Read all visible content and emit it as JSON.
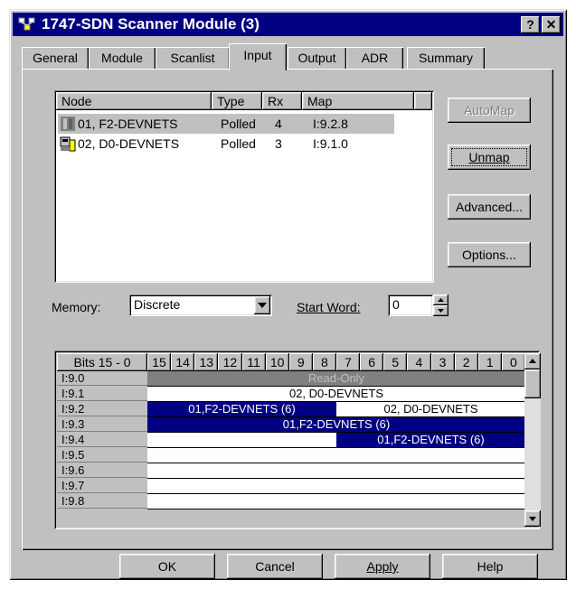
{
  "window": {
    "title": "1747-SDN Scanner Module (3)",
    "help_btn": "?",
    "close_btn": "✕"
  },
  "tabs": [
    "General",
    "Module",
    "Scanlist",
    "Input",
    "Output",
    "ADR",
    "Summary"
  ],
  "active_tab": "Input",
  "device_list": {
    "columns": [
      "Node",
      "Type",
      "Rx",
      "Map"
    ],
    "rows": [
      {
        "node": "01, F2-DEVNETS",
        "type": "Polled",
        "rx": "4",
        "map": "I:9.2.8",
        "selected": true
      },
      {
        "node": "02, D0-DEVNETS",
        "type": "Polled",
        "rx": "3",
        "map": "I:9.1.0",
        "selected": false
      }
    ]
  },
  "side_buttons": {
    "automap": "AutoMap",
    "unmap": "Unmap",
    "advanced": "Advanced...",
    "options": "Options..."
  },
  "memory": {
    "label": "Memory:",
    "value": "Discrete"
  },
  "start_word": {
    "label": "Start Word:",
    "value": "0"
  },
  "bit_grid": {
    "header_label": "Bits 15 - 0",
    "bits": [
      "15",
      "14",
      "13",
      "12",
      "11",
      "10",
      "9",
      "8",
      "7",
      "6",
      "5",
      "4",
      "3",
      "2",
      "1",
      "0"
    ],
    "rows": [
      {
        "label": "I:9.0",
        "segments": [
          {
            "text": "Read-Only",
            "style": "gray",
            "from_bit": 15,
            "to_bit": 0
          }
        ]
      },
      {
        "label": "I:9.1",
        "segments": [
          {
            "text": "02, D0-DEVNETS",
            "style": "white",
            "from_bit": 15,
            "to_bit": 0
          }
        ]
      },
      {
        "label": "I:9.2",
        "segments": [
          {
            "text": "01,F2-DEVNETS (6)",
            "style": "blue",
            "from_bit": 15,
            "to_bit": 8
          },
          {
            "text": "02, D0-DEVNETS",
            "style": "white",
            "from_bit": 7,
            "to_bit": 0
          }
        ]
      },
      {
        "label": "I:9.3",
        "segments": [
          {
            "text": "01,F2-DEVNETS (6)",
            "style": "blue",
            "from_bit": 15,
            "to_bit": 0
          }
        ]
      },
      {
        "label": "I:9.4",
        "segments": [
          {
            "text": "",
            "style": "white",
            "from_bit": 15,
            "to_bit": 8
          },
          {
            "text": "01,F2-DEVNETS (6)",
            "style": "blue",
            "from_bit": 7,
            "to_bit": 0
          }
        ]
      },
      {
        "label": "I:9.5",
        "segments": []
      },
      {
        "label": "I:9.6",
        "segments": []
      },
      {
        "label": "I:9.7",
        "segments": []
      },
      {
        "label": "I:9.8",
        "segments": []
      }
    ]
  },
  "footer_buttons": {
    "ok": "OK",
    "cancel": "Cancel",
    "apply": "Apply",
    "help": "Help"
  },
  "colors": {
    "titlebar": "#000080",
    "face": "#c0c0c0",
    "selection": "#000080"
  }
}
